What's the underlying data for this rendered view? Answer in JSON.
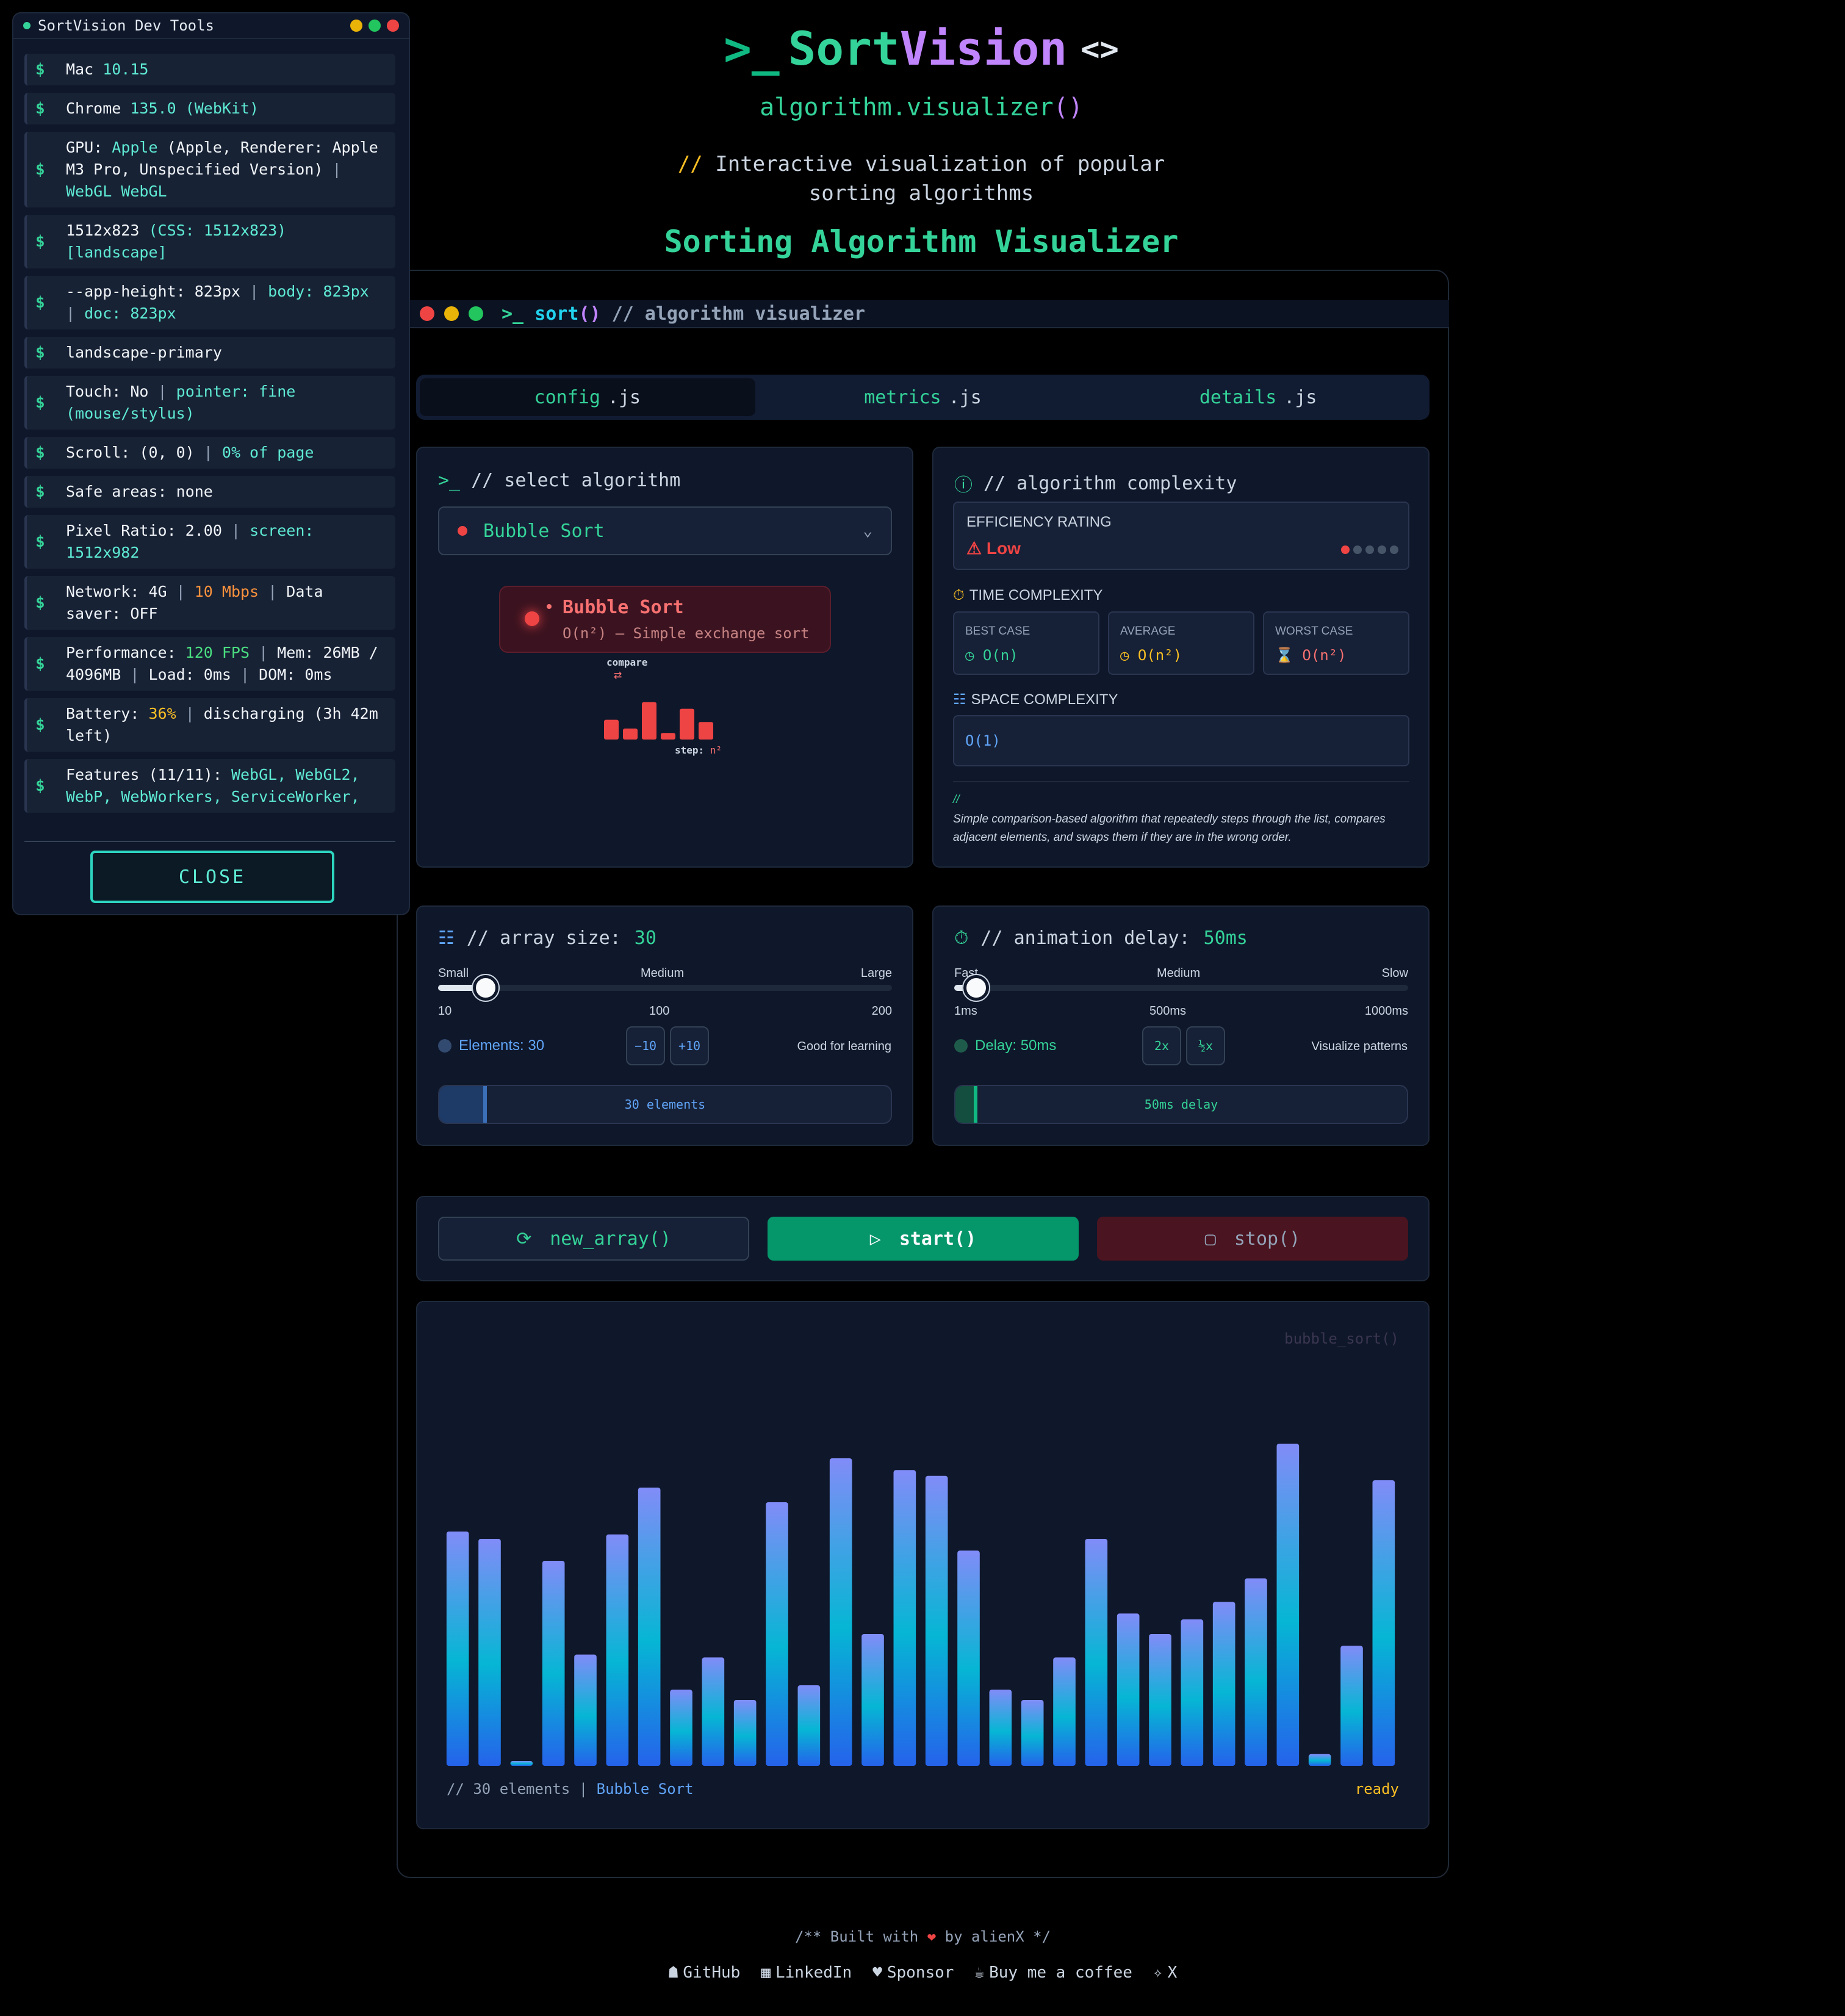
{
  "header": {
    "prompt": ">_",
    "title_a": "Sort",
    "title_b": "Vision",
    "code_icon": "<>",
    "subtitle_a": "algorithm.visualizer",
    "subtitle_b": "()",
    "desc_comment": "//",
    "desc_line1": "Interactive visualization of popular",
    "desc_line2": "sorting algorithms",
    "heading": "Sorting Algorithm Visualizer"
  },
  "window": {
    "prompt": ">_",
    "fn": "sort",
    "parens": "()",
    "comment": "// algorithm visualizer",
    "dot_colors": [
      "#ef4444",
      "#eab308",
      "#22c55e"
    ]
  },
  "tabs": [
    {
      "name": "config",
      "ext": ".js"
    },
    {
      "name": "metrics",
      "ext": ".js"
    },
    {
      "name": "details",
      "ext": ".js"
    }
  ],
  "algo": {
    "title": "// select algorithm",
    "selected": "Bubble Sort",
    "badge_name": "Bubble Sort",
    "badge_desc": "O(n²) — Simple exchange sort",
    "mini_compare": "compare",
    "mini_step_label": "step:",
    "mini_step_val": "n²",
    "mini_values": [
      0.45,
      0.25,
      0.85,
      0.15,
      0.7,
      0.4
    ]
  },
  "complexity": {
    "title": "// algorithm complexity",
    "eff_label": "EFFICIENCY RATING",
    "eff_value": "Low",
    "eff_level": 1,
    "eff_max": 5,
    "time_label": "TIME COMPLEXITY",
    "best_label": "BEST CASE",
    "best_value": "O(n)",
    "avg_label": "AVERAGE",
    "avg_value": "O(n²)",
    "worst_label": "WORST CASE",
    "worst_value": "O(n²)",
    "space_label": "SPACE COMPLEXITY",
    "space_value": "O(1)",
    "note_mark": "//",
    "note": "Simple comparison-based algorithm that repeatedly steps through the list, compares adjacent elements, and swaps them if they are in the wrong order."
  },
  "size": {
    "title": "// array size:",
    "value": "30",
    "marks": [
      "Small",
      "Medium",
      "Large"
    ],
    "range": [
      "10",
      "100",
      "200"
    ],
    "info": "Elements: 30",
    "minus": "−10",
    "plus": "+10",
    "hint": "Good for learning",
    "bar_text": "30 elements",
    "fraction": 0.105
  },
  "delay": {
    "title": "// animation delay:",
    "value": "50ms",
    "marks": [
      "Fast",
      "Medium",
      "Slow"
    ],
    "range": [
      "1ms",
      "500ms",
      "1000ms"
    ],
    "info": "Delay: 50ms",
    "faster": "2x",
    "slower": "½x",
    "hint": "Visualize patterns",
    "bar_text": "50ms delay",
    "fraction": 0.049
  },
  "actions": {
    "new": "new_array()",
    "start": "start()",
    "stop": "stop()"
  },
  "viz": {
    "watermark": "bubble_sort()",
    "footer_left": "// 30 elements |",
    "footer_algo": "Bubble Sort",
    "status": "ready",
    "values": [
      160,
      155,
      3,
      140,
      76,
      158,
      190,
      52,
      74,
      45,
      180,
      55,
      210,
      90,
      202,
      198,
      147,
      52,
      45,
      74,
      155,
      104,
      90,
      100,
      112,
      128,
      220,
      8,
      82,
      195
    ],
    "max": 225
  },
  "footer": {
    "built_a": "/** Built with",
    "heart": "❤",
    "built_b": "by alienX */",
    "links": [
      {
        "icon": "github-icon",
        "glyph": "☗",
        "label": "GitHub"
      },
      {
        "icon": "linkedin-icon",
        "glyph": "▦",
        "label": "LinkedIn"
      },
      {
        "icon": "heart-icon",
        "glyph": "♥",
        "label": "Sponsor"
      },
      {
        "icon": "coffee-icon",
        "glyph": "☕",
        "label": "Buy me a coffee"
      },
      {
        "icon": "twitter-icon",
        "glyph": "✧",
        "label": "X"
      }
    ]
  },
  "devtools": {
    "title": "SortVision Dev Tools",
    "close": "CLOSE"
  }
}
